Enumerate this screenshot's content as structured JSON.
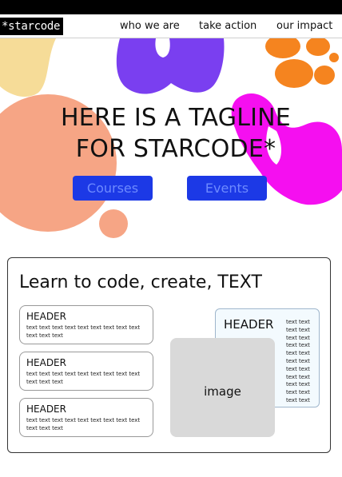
{
  "brand": {
    "logo_text": "*starcode"
  },
  "nav": {
    "items": [
      "who we are",
      "take action",
      "our impact"
    ]
  },
  "hero": {
    "tagline_line1": "HERE IS A TAGLINE",
    "tagline_line2": "FOR STARCODE*",
    "buttons": [
      "Courses",
      "Events"
    ]
  },
  "card": {
    "title": "Learn to code, create, TEXT",
    "features": [
      {
        "header": "HEADER",
        "body": "text text text text text text text text text text text text"
      },
      {
        "header": "HEADER",
        "body": "text text text text text text text text text text text text"
      },
      {
        "header": "HEADER",
        "body": "text text text text text text text text text text text text"
      }
    ],
    "side_panel": {
      "header": "HEADER",
      "text": "text text text text text text text text text text text text text text text text text text text text text text"
    },
    "image_label": "image"
  },
  "colors": {
    "top_bar": "#000000",
    "button_bg": "#1c39e6",
    "button_text": "#6d8aff",
    "blob_yellow": "#f6dc98",
    "blob_purple": "#7a3ff0",
    "blob_orange": "#f5841f",
    "blob_peach": "#f6a585",
    "blob_magenta": "#f50ff0"
  }
}
